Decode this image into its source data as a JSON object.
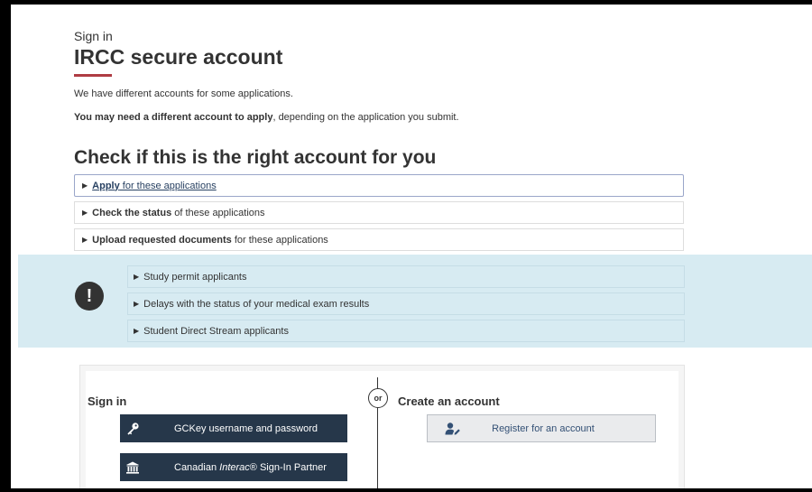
{
  "header": {
    "eyebrow": "Sign in",
    "title": "IRCC secure account"
  },
  "intro": {
    "line1": "We have different accounts for some applications.",
    "line2_bold": "You may need a different account to apply",
    "line2_rest": ", depending on the application you submit."
  },
  "check": {
    "heading": "Check if this is the right account for you",
    "items": [
      {
        "bold": "Apply",
        "rest": " for these applications"
      },
      {
        "bold": "Check the status",
        "rest": " of these applications"
      },
      {
        "bold": "Upload requested documents",
        "rest": " for these applications"
      }
    ]
  },
  "alert": {
    "icon": "exclamation-icon",
    "items": [
      "Study permit applicants",
      "Delays with the status of your medical exam results",
      "Student Direct Stream applicants"
    ]
  },
  "signin": {
    "heading": "Sign in",
    "gckey_label": "GCKey username and password",
    "interac_prefix": "Canadian ",
    "interac_italic": "Interac",
    "interac_suffix": "® Sign-In Partner",
    "or_label": "or",
    "create_heading": "Create an account",
    "register_label": "Register for an account"
  },
  "colors": {
    "accent_red": "#af3c43",
    "button_dark": "#26374a",
    "alert_bg": "#d7ebf2",
    "link": "#284162"
  }
}
